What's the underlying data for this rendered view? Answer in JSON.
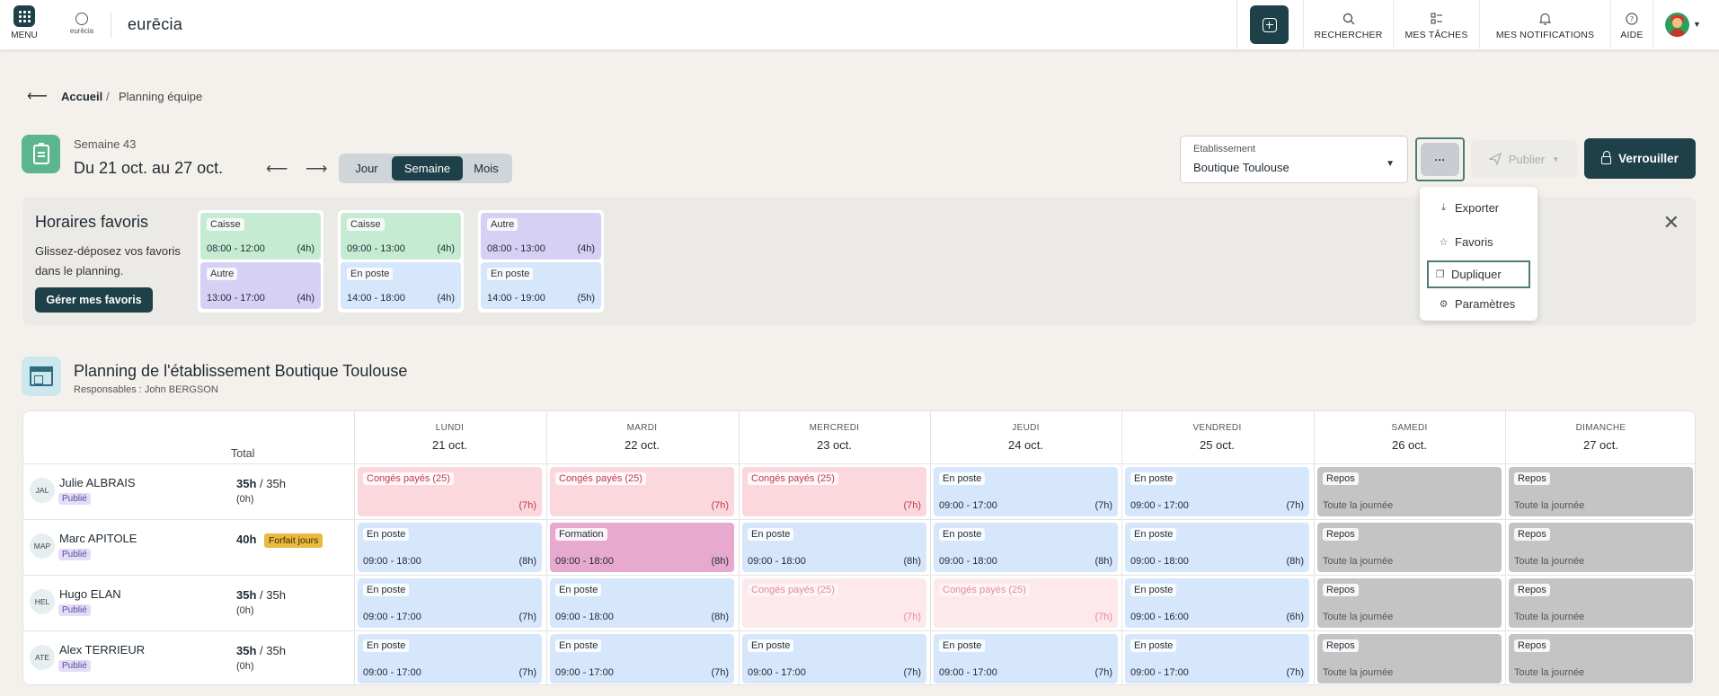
{
  "topbar": {
    "menu_label": "MENU",
    "logo_small": "eurēcia",
    "brand": "eurēcia",
    "nav": [
      {
        "label": "RECHERCHER",
        "icon": "search-icon"
      },
      {
        "label": "MES TÂCHES",
        "icon": "tasks-icon"
      },
      {
        "label": "MES NOTIFICATIONS",
        "icon": "bell-icon"
      },
      {
        "label": "AIDE",
        "icon": "help-icon"
      }
    ]
  },
  "breadcrumb": {
    "home": "Accueil",
    "separator": "/",
    "current": "Planning équipe"
  },
  "week": {
    "label": "Semaine 43",
    "range": "Du 21 oct. au 27 oct.",
    "views": [
      "Jour",
      "Semaine",
      "Mois"
    ],
    "active_view": "Semaine"
  },
  "etablissement": {
    "label": "Etablissement",
    "value": "Boutique Toulouse"
  },
  "actions": {
    "more": "···",
    "publish": "Publier",
    "lock": "Verrouiller"
  },
  "dropdown": [
    {
      "label": "Exporter",
      "icon": "download-icon"
    },
    {
      "label": "Favoris",
      "icon": "star-icon"
    },
    {
      "label": "Dupliquer",
      "icon": "copy-icon"
    },
    {
      "label": "Paramètres",
      "icon": "settings-icon"
    }
  ],
  "favorites": {
    "title": "Horaires favoris",
    "description": "Glissez-déposez vos favoris dans le planning.",
    "manage_label": "Gérer mes favoris",
    "columns": [
      [
        {
          "tag": "Caisse",
          "time": "08:00 - 12:00",
          "dur": "(4h)",
          "color": "#c5ecd2"
        },
        {
          "tag": "Autre",
          "time": "13:00 - 17:00",
          "dur": "(4h)",
          "color": "#d6d0f5"
        }
      ],
      [
        {
          "tag": "Caisse",
          "time": "09:00 - 13:00",
          "dur": "(4h)",
          "color": "#c5ecd2"
        },
        {
          "tag": "En poste",
          "time": "14:00 - 18:00",
          "dur": "(4h)",
          "color": "#d6e6fb"
        }
      ],
      [
        {
          "tag": "Autre",
          "time": "08:00 - 13:00",
          "dur": "(4h)",
          "color": "#d6d0f5"
        },
        {
          "tag": "En poste",
          "time": "14:00 - 19:00",
          "dur": "(5h)",
          "color": "#d6e6fb"
        }
      ]
    ]
  },
  "planning": {
    "title": "Planning de l'établissement Boutique Toulouse",
    "responsables": "Responsables : John BERGSON",
    "total_label": "Total",
    "days": [
      {
        "name": "LUNDI",
        "date": "21 oct."
      },
      {
        "name": "MARDI",
        "date": "22 oct."
      },
      {
        "name": "MERCREDI",
        "date": "23 oct."
      },
      {
        "name": "JEUDI",
        "date": "24 oct."
      },
      {
        "name": "VENDREDI",
        "date": "25 oct."
      },
      {
        "name": "SAMEDI",
        "date": "26 oct."
      },
      {
        "name": "DIMANCHE",
        "date": "27 oct."
      }
    ],
    "employees": [
      {
        "initials": "JAL",
        "name": "Julie ALBRAIS",
        "status": "Publié",
        "hours": "35h",
        "hours_of": " / 35h",
        "sub": "(0h)",
        "forfait": "",
        "shifts": [
          {
            "type": "cp",
            "tag": "Congés payés (25)",
            "time": "",
            "dur": "(7h)"
          },
          {
            "type": "cp",
            "tag": "Congés payés (25)",
            "time": "",
            "dur": "(7h)"
          },
          {
            "type": "cp",
            "tag": "Congés payés (25)",
            "time": "",
            "dur": "(7h)"
          },
          {
            "type": "poste",
            "tag": "En poste",
            "time": "09:00 - 17:00",
            "dur": "(7h)"
          },
          {
            "type": "poste",
            "tag": "En poste",
            "time": "09:00 - 17:00",
            "dur": "(7h)"
          },
          {
            "type": "repos",
            "tag": "Repos",
            "time": "Toute la journée",
            "dur": ""
          },
          {
            "type": "repos",
            "tag": "Repos",
            "time": "Toute la journée",
            "dur": ""
          }
        ]
      },
      {
        "initials": "MAP",
        "name": "Marc APITOLE",
        "status": "Publié",
        "hours": "40h",
        "hours_of": "",
        "sub": "",
        "forfait": "Forfait jours",
        "shifts": [
          {
            "type": "poste",
            "tag": "En poste",
            "time": "09:00 - 18:00",
            "dur": "(8h)"
          },
          {
            "type": "form",
            "tag": "Formation",
            "time": "09:00 - 18:00",
            "dur": "(8h)"
          },
          {
            "type": "poste",
            "tag": "En poste",
            "time": "09:00 - 18:00",
            "dur": "(8h)"
          },
          {
            "type": "poste",
            "tag": "En poste",
            "time": "09:00 - 18:00",
            "dur": "(8h)"
          },
          {
            "type": "poste",
            "tag": "En poste",
            "time": "09:00 - 18:00",
            "dur": "(8h)"
          },
          {
            "type": "repos",
            "tag": "Repos",
            "time": "Toute la journée",
            "dur": ""
          },
          {
            "type": "repos",
            "tag": "Repos",
            "time": "Toute la journée",
            "dur": ""
          }
        ]
      },
      {
        "initials": "HEL",
        "name": "Hugo ELAN",
        "status": "Publié",
        "hours": "35h",
        "hours_of": " / 35h",
        "sub": "(0h)",
        "forfait": "",
        "shifts": [
          {
            "type": "poste",
            "tag": "En poste",
            "time": "09:00 - 17:00",
            "dur": "(7h)"
          },
          {
            "type": "poste",
            "tag": "En poste",
            "time": "09:00 - 18:00",
            "dur": "(8h)"
          },
          {
            "type": "cp-light",
            "tag": "Congés payés (25)",
            "time": "",
            "dur": "(7h)"
          },
          {
            "type": "cp-light",
            "tag": "Congés payés (25)",
            "time": "",
            "dur": "(7h)"
          },
          {
            "type": "poste",
            "tag": "En poste",
            "time": "09:00 - 16:00",
            "dur": "(6h)"
          },
          {
            "type": "repos",
            "tag": "Repos",
            "time": "Toute la journée",
            "dur": ""
          },
          {
            "type": "repos",
            "tag": "Repos",
            "time": "Toute la journée",
            "dur": ""
          }
        ]
      },
      {
        "initials": "ATE",
        "name": "Alex TERRIEUR",
        "status": "Publié",
        "hours": "35h",
        "hours_of": " / 35h",
        "sub": "(0h)",
        "forfait": "",
        "shifts": [
          {
            "type": "poste",
            "tag": "En poste",
            "time": "09:00 - 17:00",
            "dur": "(7h)"
          },
          {
            "type": "poste",
            "tag": "En poste",
            "time": "09:00 - 17:00",
            "dur": "(7h)"
          },
          {
            "type": "poste",
            "tag": "En poste",
            "time": "09:00 - 17:00",
            "dur": "(7h)"
          },
          {
            "type": "poste",
            "tag": "En poste",
            "time": "09:00 - 17:00",
            "dur": "(7h)"
          },
          {
            "type": "poste",
            "tag": "En poste",
            "time": "09:00 - 17:00",
            "dur": "(7h)"
          },
          {
            "type": "repos",
            "tag": "Repos",
            "time": "Toute la journée",
            "dur": ""
          },
          {
            "type": "repos",
            "tag": "Repos",
            "time": "Toute la journée",
            "dur": ""
          }
        ]
      }
    ]
  }
}
